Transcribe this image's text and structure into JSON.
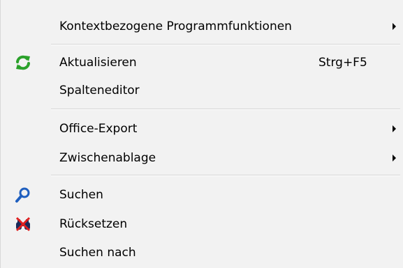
{
  "menu": {
    "items": [
      {
        "label": "Kontextbezogene Programmfunktionen",
        "icon": "",
        "submenu": true
      },
      {
        "label": "Aktualisieren",
        "icon": "refresh-icon",
        "shortcut": "Strg+F5"
      },
      {
        "label": "Spalteneditor",
        "icon": ""
      },
      {
        "label": "Office-Export",
        "icon": "",
        "submenu": true
      },
      {
        "label": "Zwischenablage",
        "icon": "",
        "submenu": true
      },
      {
        "label": "Suchen",
        "icon": "search-icon"
      },
      {
        "label": "Rücksetzen",
        "icon": "binoculars-reset-icon"
      },
      {
        "label": "Suchen nach",
        "icon": ""
      }
    ]
  },
  "colors": {
    "background": "#f2f2f2",
    "separator": "#d5d5d5",
    "refresh_icon": "#2aa12a",
    "search_icon": "#1f5fbf",
    "reset_icon_cross": "#e02020"
  }
}
